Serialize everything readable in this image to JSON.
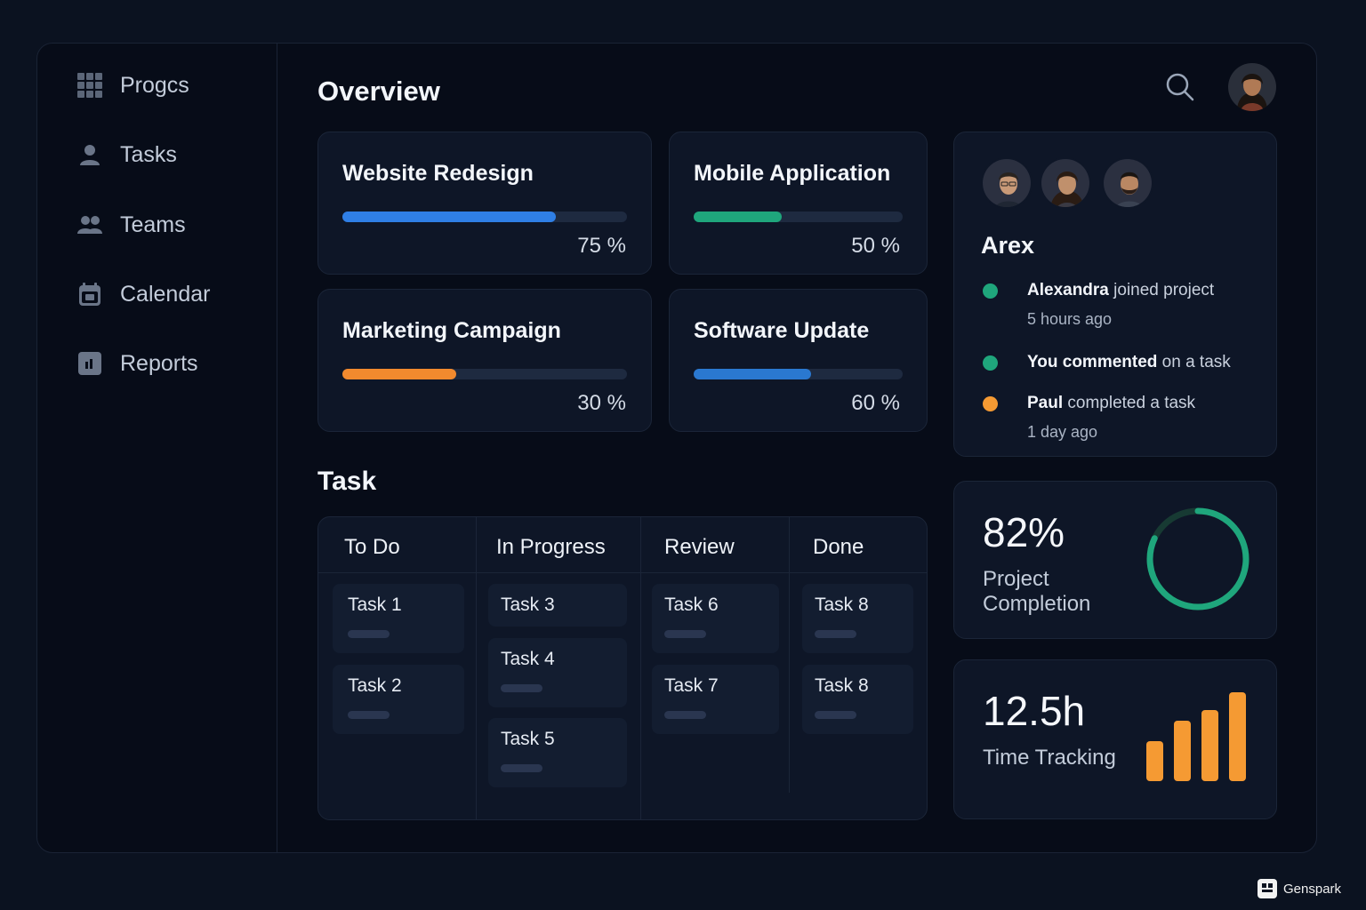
{
  "sidebar": {
    "items": [
      {
        "label": "Progcs",
        "icon": "grid-icon"
      },
      {
        "label": "Tasks",
        "icon": "user-icon"
      },
      {
        "label": "Teams",
        "icon": "users-icon"
      },
      {
        "label": "Calendar",
        "icon": "calendar-icon"
      },
      {
        "label": "Reports",
        "icon": "reports-icon"
      }
    ]
  },
  "header": {
    "title": "Overview",
    "search_icon": "search-icon",
    "avatar_icon": "user-avatar"
  },
  "projects": [
    {
      "name": "Website Redesign",
      "percent_label": "75 %",
      "progress": 0.75,
      "color": "#2f7fe6"
    },
    {
      "name": "Mobile Application",
      "percent_label": "50 %",
      "progress": 0.42,
      "color": "#1fa67c"
    },
    {
      "name": "Marketing Campaign",
      "percent_label": "30 %",
      "progress": 0.4,
      "color": "#f28a2e"
    },
    {
      "name": "Software Update",
      "percent_label": "60 %",
      "progress": 0.56,
      "color": "#2a78d0"
    }
  ],
  "tasks_section": {
    "title": "Task",
    "columns": [
      {
        "title": "To Do",
        "tasks": [
          "Task 1",
          "Task 2"
        ]
      },
      {
        "title": "In Progress",
        "tasks": [
          "Task 3",
          "Task 4",
          "Task 5"
        ]
      },
      {
        "title": "Review",
        "tasks": [
          "Task 6",
          "Task 7"
        ]
      },
      {
        "title": "Done",
        "tasks": [
          "Task 8",
          "Task 8"
        ]
      }
    ]
  },
  "activity": {
    "name": "Arex",
    "items": [
      {
        "actor": "Alexandra",
        "action": " joined project",
        "time": "5 hours ago",
        "color": "#1fa67c"
      },
      {
        "actor": "You commented",
        "action": " on a task",
        "time": "",
        "color": "#1fa67c"
      },
      {
        "actor": "Paul",
        "action": " completed a task",
        "time": "1 day ago",
        "color": "#f59a33"
      }
    ]
  },
  "completion": {
    "value": "82%",
    "label": "Project Completion",
    "progress": 0.82,
    "color": "#1fa67c"
  },
  "time_tracking": {
    "value": "12.5h",
    "label": "Time Tracking",
    "bars": [
      0.45,
      0.68,
      0.8,
      1.0
    ],
    "color": "#f59a33"
  },
  "watermark": "Genspark"
}
